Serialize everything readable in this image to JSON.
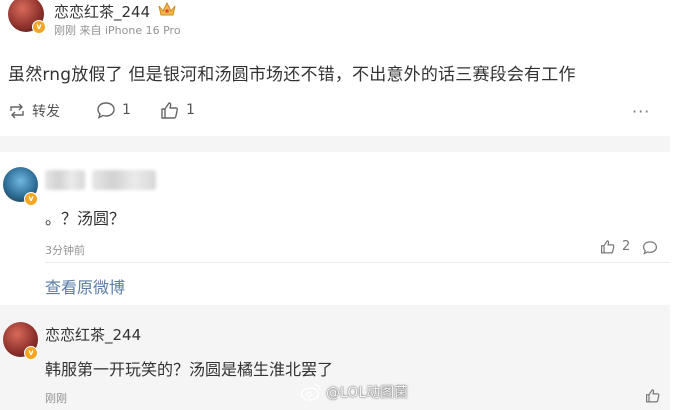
{
  "post": {
    "username": "恋恋红茶_244",
    "meta": "刚刚 来自 iPhone 16 Pro",
    "text": "虽然rng放假了 但是银河和汤圆市场还不错，不出意外的话三赛段会有工作",
    "repost_label": "转发",
    "comment_count": "1",
    "like_count": "1"
  },
  "reply1": {
    "text": "。？汤圆？",
    "time": "3分钟前",
    "like_count": "2",
    "view_original": "查看原微博"
  },
  "reply2": {
    "username": "恋恋红茶_244",
    "text": "韩服第一开玩笑的？汤圆是橘生淮北罢了",
    "time": "刚刚"
  },
  "watermark": "@LOL动图菌",
  "colors": {
    "badge": "#f5a623",
    "link": "#5a7ca8",
    "band": "#f5f5f5"
  }
}
